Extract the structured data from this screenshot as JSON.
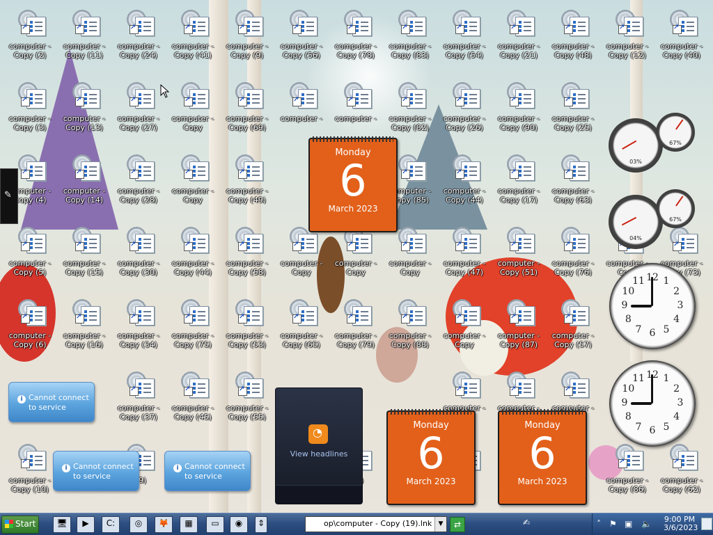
{
  "desktop": {
    "icon_rows": [
      [
        {
          "line1": "computer -",
          "line2": "Copy (2)"
        },
        {
          "line1": "computer -",
          "line2": "Copy (11)"
        },
        {
          "line1": "computer -",
          "line2": "Copy (24)"
        },
        {
          "line1": "computer -",
          "line2": "Copy (41)"
        },
        {
          "line1": "computer -",
          "line2": "Copy (9)"
        },
        {
          "line1": "computer -",
          "line2": "Copy (56)"
        },
        {
          "line1": "computer -",
          "line2": "Copy (78)"
        },
        {
          "line1": "computer -",
          "line2": "Copy (83)"
        },
        {
          "line1": "computer -",
          "line2": "Copy (54)"
        },
        {
          "line1": "computer -",
          "line2": "Copy (21)"
        },
        {
          "line1": "computer -",
          "line2": "Copy (48)"
        },
        {
          "line1": "computer -",
          "line2": "Copy (12)"
        },
        {
          "line1": "computer -",
          "line2": "Copy (40)"
        }
      ],
      [
        {
          "line1": "computer -",
          "line2": "Copy (3)"
        },
        {
          "line1": "computer -",
          "line2": "Copy (13)"
        },
        {
          "line1": "computer -",
          "line2": "Copy (27)"
        },
        {
          "line1": "computer -",
          "line2": "Copy"
        },
        {
          "line1": "computer -",
          "line2": "Copy (69)"
        },
        {
          "line1": "computer -",
          "line2": ""
        },
        {
          "line1": "computer -",
          "line2": ""
        },
        {
          "line1": "computer -",
          "line2": "Copy (82)"
        },
        {
          "line1": "computer -",
          "line2": "Copy (26)"
        },
        {
          "line1": "computer -",
          "line2": "Copy (90)"
        },
        {
          "line1": "computer -",
          "line2": "Copy (25)"
        },
        {
          "line1": "",
          "line2": ""
        },
        {
          "line1": "",
          "line2": ""
        }
      ],
      [
        {
          "line1": "computer -",
          "line2": "Copy (4)"
        },
        {
          "line1": "computer -",
          "line2": "Copy (14)"
        },
        {
          "line1": "computer -",
          "line2": "Copy (28)"
        },
        {
          "line1": "computer -",
          "line2": "Copy"
        },
        {
          "line1": "computer -",
          "line2": "Copy (49)"
        },
        {
          "line1": "",
          "line2": ""
        },
        {
          "line1": "",
          "line2": ""
        },
        {
          "line1": "computer -",
          "line2": "Copy (85)"
        },
        {
          "line1": "computer -",
          "line2": "Copy (44)"
        },
        {
          "line1": "computer -",
          "line2": "Copy (17)"
        },
        {
          "line1": "computer -",
          "line2": "Copy (63)"
        },
        {
          "line1": "",
          "line2": ""
        },
        {
          "line1": "",
          "line2": ""
        }
      ],
      [
        {
          "line1": "computer -",
          "line2": "Copy (5)"
        },
        {
          "line1": "computer -",
          "line2": "Copy (15)"
        },
        {
          "line1": "computer -",
          "line2": "Copy (30)"
        },
        {
          "line1": "computer -",
          "line2": "Copy (44)"
        },
        {
          "line1": "computer -",
          "line2": "Copy (58)"
        },
        {
          "line1": "computer -",
          "line2": "Copy"
        },
        {
          "line1": "computer -",
          "line2": "Copy"
        },
        {
          "line1": "computer -",
          "line2": "Copy"
        },
        {
          "line1": "computer -",
          "line2": "Copy (47)"
        },
        {
          "line1": "computer -",
          "line2": "Copy (51)"
        },
        {
          "line1": "computer -",
          "line2": "Copy (76)"
        },
        {
          "line1": "computer -",
          "line2": "Copy"
        },
        {
          "line1": "computer -",
          "line2": "Copy (73)"
        }
      ],
      [
        {
          "line1": "computer -",
          "line2": "Copy (6)"
        },
        {
          "line1": "computer -",
          "line2": "Copy (16)"
        },
        {
          "line1": "computer -",
          "line2": "Copy (34)"
        },
        {
          "line1": "computer -",
          "line2": "Copy (75)"
        },
        {
          "line1": "computer -",
          "line2": "Copy (53)"
        },
        {
          "line1": "computer -",
          "line2": "Copy (65)"
        },
        {
          "line1": "computer -",
          "line2": "Copy (79)"
        },
        {
          "line1": "computer -",
          "line2": "Copy (88)"
        },
        {
          "line1": "computer -",
          "line2": "Copy"
        },
        {
          "line1": "computer -",
          "line2": "Copy (87)"
        },
        {
          "line1": "computer -",
          "line2": "Copy (57)"
        },
        {
          "line1": "",
          "line2": ""
        },
        {
          "line1": "",
          "line2": ""
        }
      ],
      [
        {
          "line1": "",
          "line2": ""
        },
        {
          "line1": "",
          "line2": ""
        },
        {
          "line1": "computer -",
          "line2": "Copy (37)"
        },
        {
          "line1": "computer -",
          "line2": "Copy (45)"
        },
        {
          "line1": "computer -",
          "line2": "Copy (55)"
        },
        {
          "line1": "",
          "line2": ""
        },
        {
          "line1": "",
          "line2": ""
        },
        {
          "line1": "",
          "line2": ""
        },
        {
          "line1": "computer -",
          "line2": "Copy"
        },
        {
          "line1": "computer -",
          "line2": "Copy"
        },
        {
          "line1": "computer -",
          "line2": ""
        },
        {
          "line1": "",
          "line2": ""
        },
        {
          "line1": "",
          "line2": ""
        }
      ],
      [
        {
          "line1": "computer -",
          "line2": "Copy (10)"
        },
        {
          "line1": "",
          "line2": ""
        },
        {
          "line1": "",
          "line2": "(39)"
        },
        {
          "line1": "",
          "line2": ""
        },
        {
          "line1": "",
          "line2": ""
        },
        {
          "line1": "",
          "line2": ""
        },
        {
          "line1": "",
          "line2": "(31)"
        },
        {
          "line1": "",
          "line2": ""
        },
        {
          "line1": "",
          "line2": "(2)"
        },
        {
          "line1": "",
          "line2": ""
        },
        {
          "line1": "",
          "line2": ""
        },
        {
          "line1": "computer -",
          "line2": "Copy (86)"
        },
        {
          "line1": "computer -",
          "line2": "Copy (62)"
        }
      ]
    ]
  },
  "calendars": [
    {
      "day": "Monday",
      "date": "6",
      "month_year": "March 2023"
    },
    {
      "day": "Monday",
      "date": "6",
      "month_year": "March 2023"
    },
    {
      "day": "Monday",
      "date": "6",
      "month_year": "March 2023"
    }
  ],
  "meters": [
    {
      "cpu": "03%",
      "mem": "67%"
    },
    {
      "cpu": "04%",
      "mem": "67%"
    }
  ],
  "clocks": [
    {
      "hour": 9,
      "minute": 0
    },
    {
      "hour": 9,
      "minute": 0
    }
  ],
  "notices": [
    {
      "text": "Cannot connect to service"
    },
    {
      "text": "Cannot connect to service"
    },
    {
      "text": "Cannot connect to service"
    }
  ],
  "feed": {
    "label": "View headlines"
  },
  "taskbar": {
    "start_label": "Start",
    "address_value": "op\\computer - Copy (19).lnk",
    "time": "9:00 PM",
    "date": "3/6/2023"
  },
  "colors": {
    "calendar": "#e2601a",
    "taskbar": "#2d4f82",
    "notice": "#5ba4de"
  }
}
